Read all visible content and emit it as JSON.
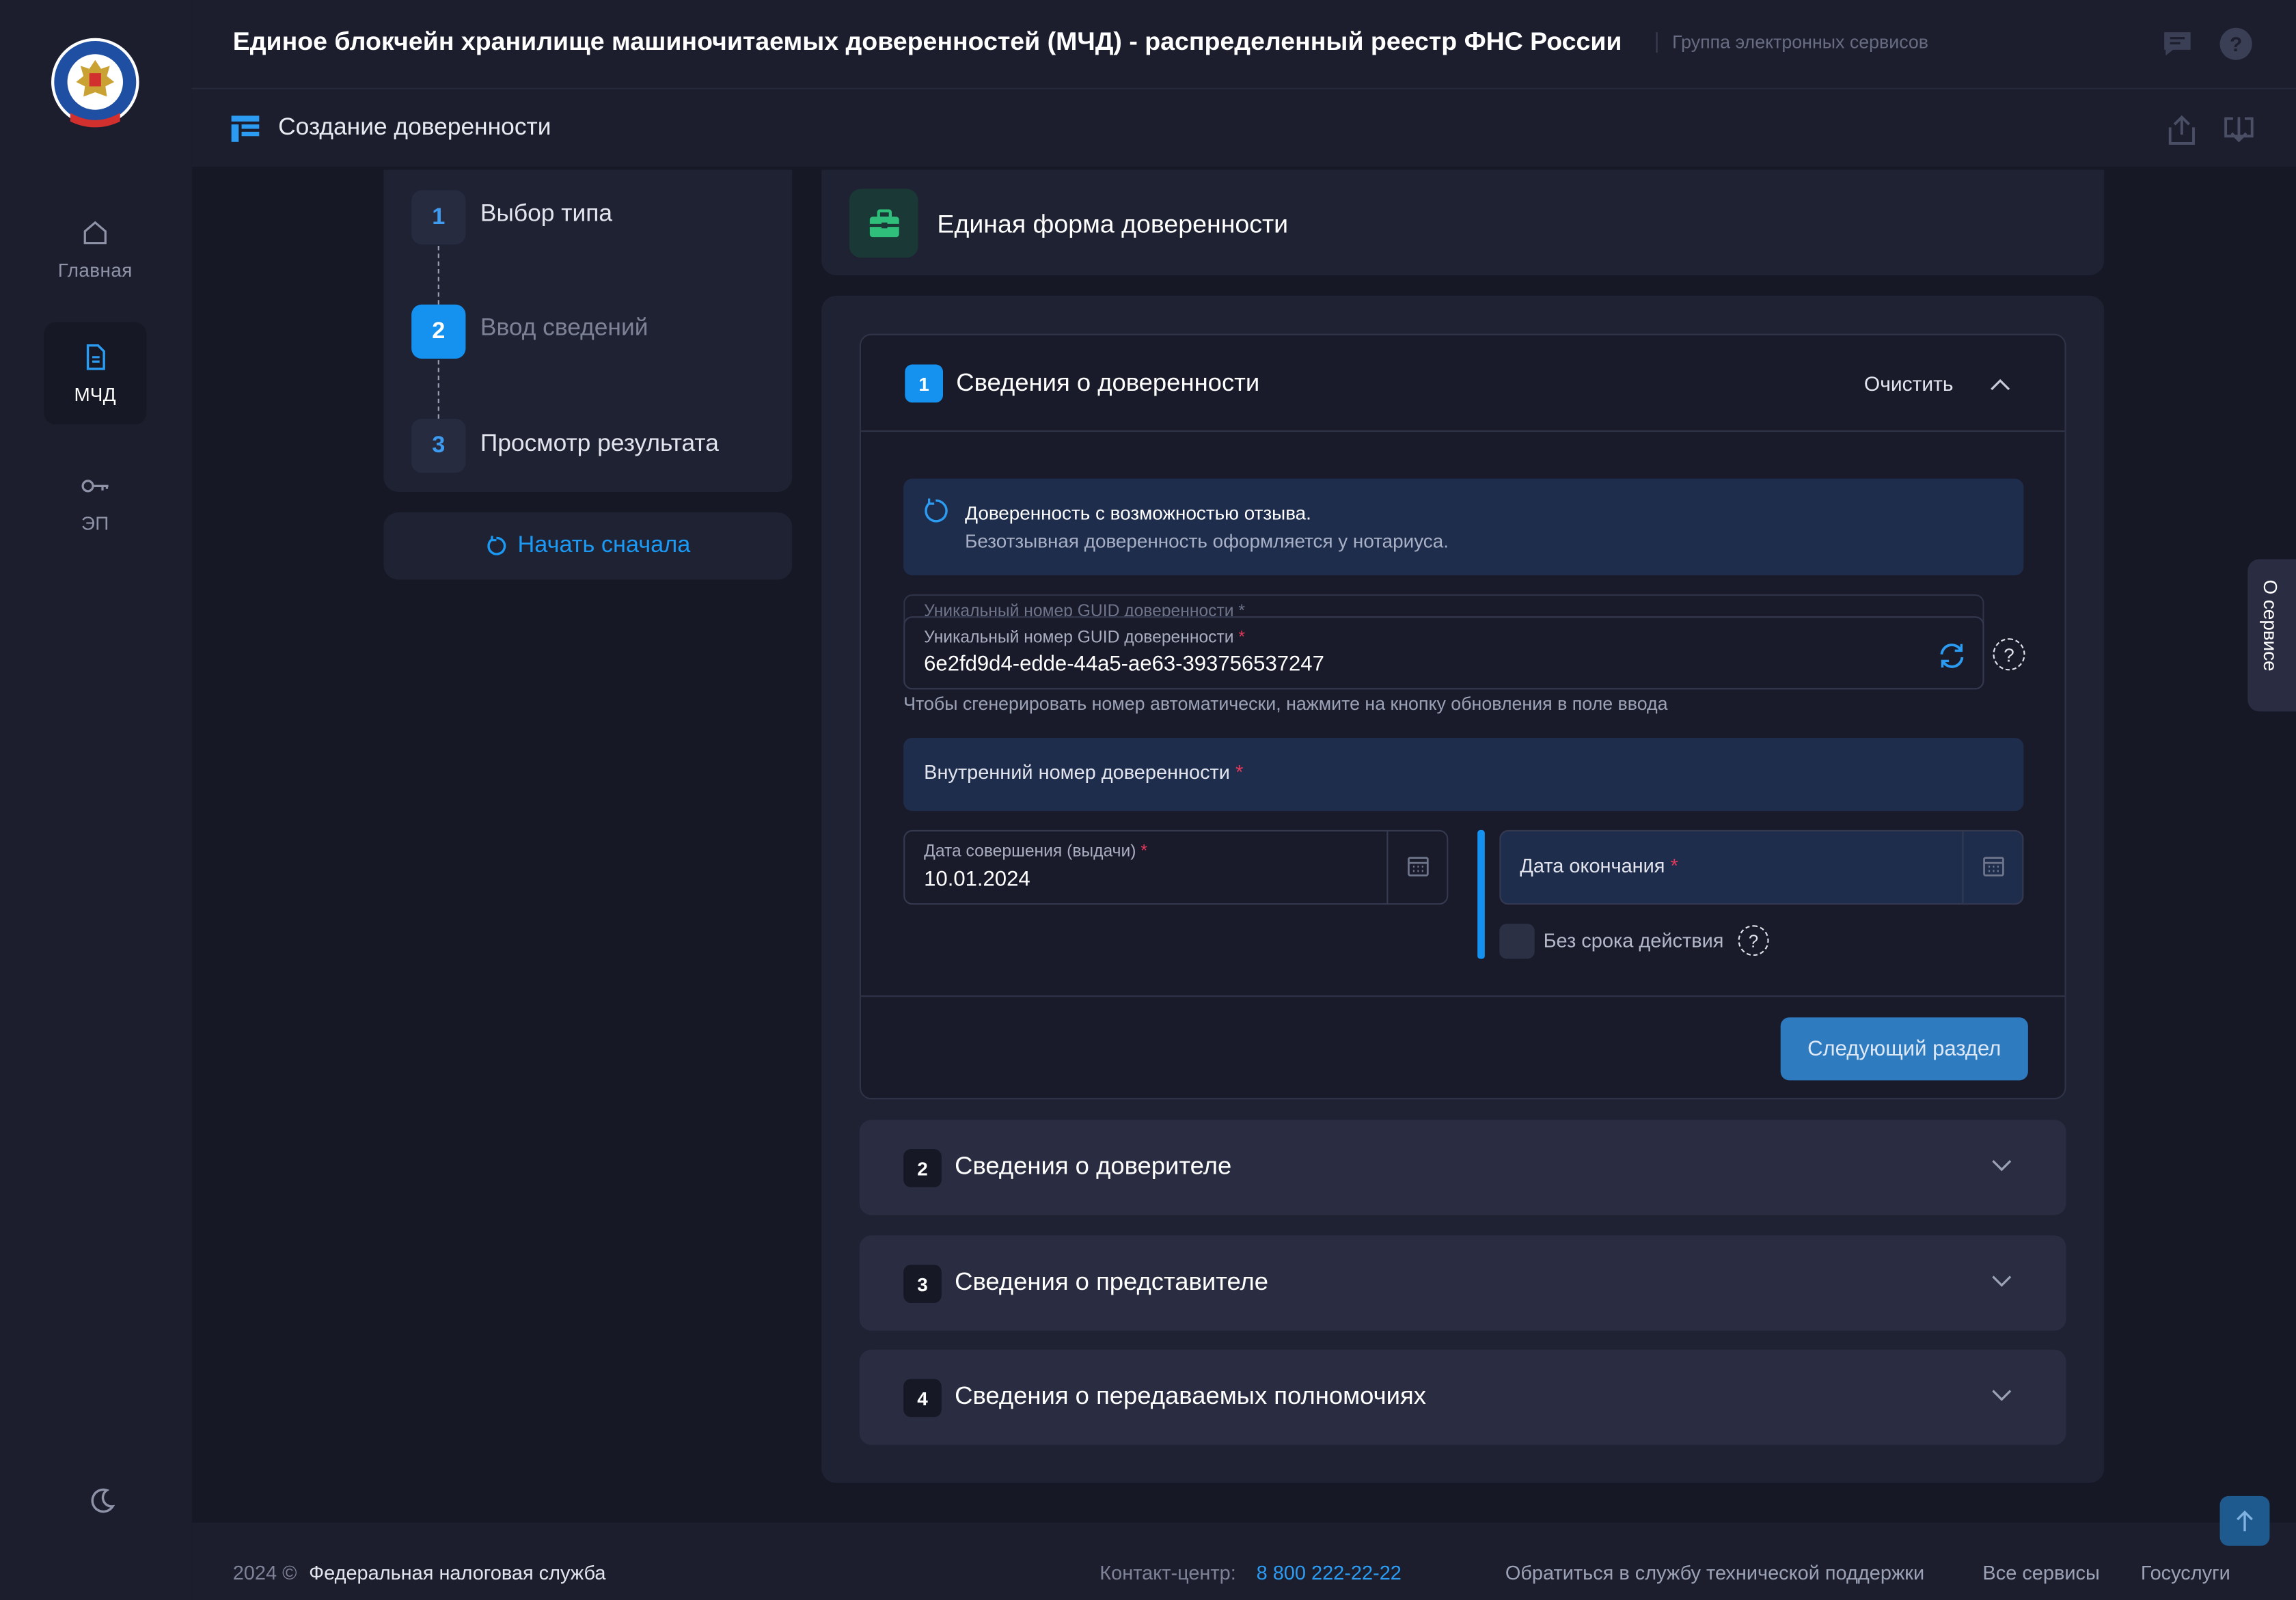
{
  "header": {
    "app_title": "Единое блокчейн хранилище машиночитаемых доверенностей (МЧД) - распределенный реестр ФНС России",
    "app_subtitle": "Группа электронных сервисов",
    "page_title": "Создание доверенности"
  },
  "sidebar": {
    "items": [
      {
        "label": "Главная",
        "icon": "home-icon"
      },
      {
        "label": "МЧД",
        "icon": "document-icon",
        "active": true
      },
      {
        "label": "ЭП",
        "icon": "key-icon"
      }
    ],
    "theme_icon": "moon-icon"
  },
  "stepper": {
    "steps": [
      {
        "num": "1",
        "label": "Выбор типа"
      },
      {
        "num": "2",
        "label": "Ввод сведений",
        "current": true
      },
      {
        "num": "3",
        "label": "Просмотр результата"
      }
    ],
    "restart_label": "Начать сначала"
  },
  "form": {
    "title": "Единая форма доверенности",
    "section1": {
      "num": "1",
      "title": "Сведения о доверенности",
      "clear_label": "Очистить",
      "info_line1": "Доверенность с возможностью отзыва.",
      "info_line2": "Безотзывная доверенность оформляется у нотариуса.",
      "guid_ghost_label": "Уникальный номер GUID доверенности *",
      "guid_label": "Уникальный номер GUID доверенности",
      "guid_value": "6e2fd9d4-edde-44a5-ae63-393756537247",
      "guid_hint": "Чтобы сгенерировать номер автоматически, нажмите на кнопку обновления в поле ввода",
      "internal_label": "Внутренний номер доверенности",
      "issue_label": "Дата совершения (выдачи)",
      "issue_value": "10.01.2024",
      "end_label": "Дата окончания",
      "no_limit_label": "Без срока действия",
      "required_mark": "*",
      "help_mark": "?",
      "next_label": "Следующий раздел"
    },
    "sections": [
      {
        "num": "2",
        "title": "Сведения о доверителе"
      },
      {
        "num": "3",
        "title": "Сведения о представителе"
      },
      {
        "num": "4",
        "title": "Сведения о передаваемых полномочиях"
      }
    ]
  },
  "about_tab": "О сервисе",
  "footer": {
    "copyright": "2024 ©",
    "org": "Федеральная налоговая служба",
    "contact_label": "Контакт-центр:",
    "contact_phone": "8 800 222-22-22",
    "support": "Обратиться в службу технической поддержки",
    "all_services": "Все сервисы",
    "gosuslugi": "Госуслуги"
  },
  "colors": {
    "accent": "#1592f0",
    "background": "#161826",
    "panel": "#1f2233",
    "required": "#e5385a"
  }
}
